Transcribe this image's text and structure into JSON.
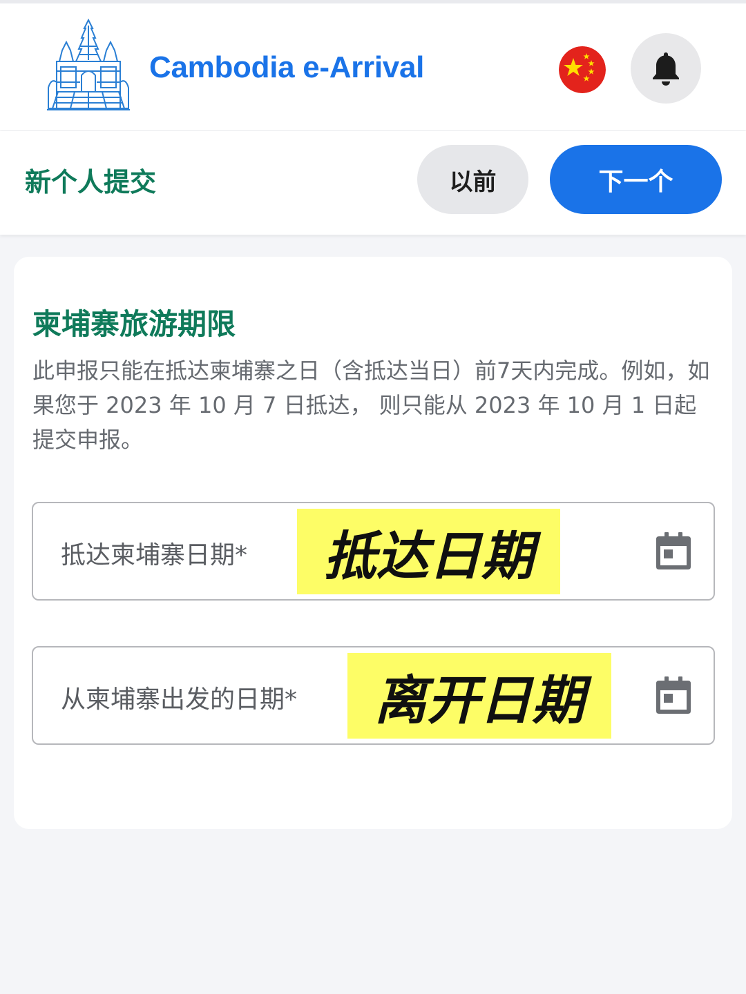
{
  "header": {
    "title": "Cambodia e-Arrival",
    "logo_icon": "angkor-temple-logo-icon",
    "language_flag": "china-flag-icon",
    "notification_icon": "bell-icon",
    "brand_color": "#1a73e8"
  },
  "actionbar": {
    "section_label": "新个人提交",
    "prev_label": "以前",
    "next_label": "下一个"
  },
  "card": {
    "title": "柬埔寨旅游期限",
    "description": "此申报只能在抵达柬埔寨之日（含抵达当日）前7天内完成。例如，如果您于 2023 年 10 月 7 日抵达， 则只能从 2023 年 10 月 1 日起提交申报。",
    "arrival_field": {
      "label": "抵达柬埔寨日期*",
      "value": "",
      "annotation": "抵达日期",
      "icon": "calendar-icon"
    },
    "departure_field": {
      "label": "从柬埔寨出发的日期*",
      "value": "",
      "annotation": "离开日期",
      "icon": "calendar-icon"
    }
  },
  "colors": {
    "accent_green": "#0f7a5a",
    "primary_blue": "#1a73e8",
    "highlight_yellow": "#fdfd66"
  }
}
